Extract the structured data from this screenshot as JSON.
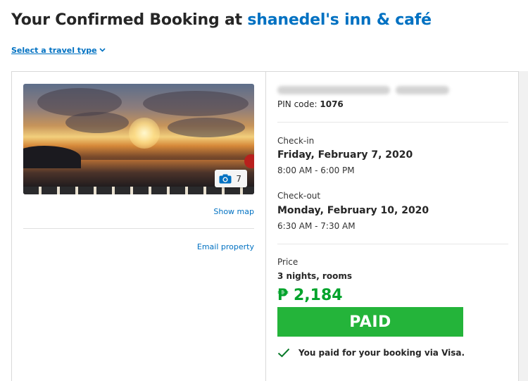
{
  "header": {
    "title_prefix": "Your Confirmed Booking at ",
    "hotel_name": "shanedel's inn & café",
    "travel_type_label": "Select a travel type"
  },
  "property": {
    "photo_count": "7",
    "show_map_label": "Show map",
    "email_property_label": "Email property"
  },
  "booking": {
    "pin_label": "PIN code: ",
    "pin_value": "1076",
    "checkin": {
      "label": "Check-in",
      "date": "Friday, February 7, 2020",
      "time": "8:00 AM - 6:00 PM"
    },
    "checkout": {
      "label": "Check-out",
      "date": "Monday, February 10, 2020",
      "time": "6:30 AM - 7:30 AM"
    },
    "price": {
      "label": "Price",
      "stay_summary": "3 nights, rooms",
      "amount": "₱ 2,184",
      "status": "PAID",
      "payment_note": "You paid for your booking via Visa."
    }
  },
  "colors": {
    "link_blue": "#0071c2",
    "price_green": "#00a32b",
    "paid_green": "#24b43a",
    "check_green": "#0a7a2a"
  },
  "icons": {
    "chevron": "chevron-down-icon",
    "camera": "camera-icon",
    "check": "checkmark-icon"
  }
}
